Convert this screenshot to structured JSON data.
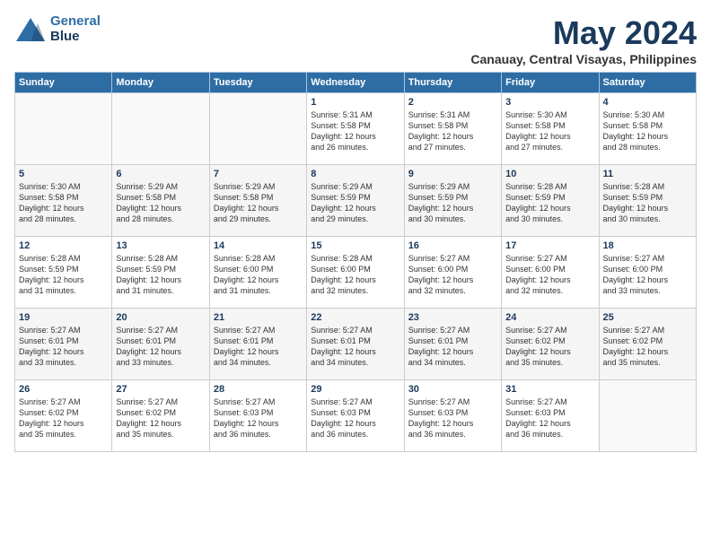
{
  "header": {
    "logo_line1": "General",
    "logo_line2": "Blue",
    "month": "May 2024",
    "location": "Canauay, Central Visayas, Philippines"
  },
  "days_of_week": [
    "Sunday",
    "Monday",
    "Tuesday",
    "Wednesday",
    "Thursday",
    "Friday",
    "Saturday"
  ],
  "weeks": [
    [
      {
        "day": "",
        "info": ""
      },
      {
        "day": "",
        "info": ""
      },
      {
        "day": "",
        "info": ""
      },
      {
        "day": "1",
        "info": "Sunrise: 5:31 AM\nSunset: 5:58 PM\nDaylight: 12 hours\nand 26 minutes."
      },
      {
        "day": "2",
        "info": "Sunrise: 5:31 AM\nSunset: 5:58 PM\nDaylight: 12 hours\nand 27 minutes."
      },
      {
        "day": "3",
        "info": "Sunrise: 5:30 AM\nSunset: 5:58 PM\nDaylight: 12 hours\nand 27 minutes."
      },
      {
        "day": "4",
        "info": "Sunrise: 5:30 AM\nSunset: 5:58 PM\nDaylight: 12 hours\nand 28 minutes."
      }
    ],
    [
      {
        "day": "5",
        "info": "Sunrise: 5:30 AM\nSunset: 5:58 PM\nDaylight: 12 hours\nand 28 minutes."
      },
      {
        "day": "6",
        "info": "Sunrise: 5:29 AM\nSunset: 5:58 PM\nDaylight: 12 hours\nand 28 minutes."
      },
      {
        "day": "7",
        "info": "Sunrise: 5:29 AM\nSunset: 5:58 PM\nDaylight: 12 hours\nand 29 minutes."
      },
      {
        "day": "8",
        "info": "Sunrise: 5:29 AM\nSunset: 5:59 PM\nDaylight: 12 hours\nand 29 minutes."
      },
      {
        "day": "9",
        "info": "Sunrise: 5:29 AM\nSunset: 5:59 PM\nDaylight: 12 hours\nand 30 minutes."
      },
      {
        "day": "10",
        "info": "Sunrise: 5:28 AM\nSunset: 5:59 PM\nDaylight: 12 hours\nand 30 minutes."
      },
      {
        "day": "11",
        "info": "Sunrise: 5:28 AM\nSunset: 5:59 PM\nDaylight: 12 hours\nand 30 minutes."
      }
    ],
    [
      {
        "day": "12",
        "info": "Sunrise: 5:28 AM\nSunset: 5:59 PM\nDaylight: 12 hours\nand 31 minutes."
      },
      {
        "day": "13",
        "info": "Sunrise: 5:28 AM\nSunset: 5:59 PM\nDaylight: 12 hours\nand 31 minutes."
      },
      {
        "day": "14",
        "info": "Sunrise: 5:28 AM\nSunset: 6:00 PM\nDaylight: 12 hours\nand 31 minutes."
      },
      {
        "day": "15",
        "info": "Sunrise: 5:28 AM\nSunset: 6:00 PM\nDaylight: 12 hours\nand 32 minutes."
      },
      {
        "day": "16",
        "info": "Sunrise: 5:27 AM\nSunset: 6:00 PM\nDaylight: 12 hours\nand 32 minutes."
      },
      {
        "day": "17",
        "info": "Sunrise: 5:27 AM\nSunset: 6:00 PM\nDaylight: 12 hours\nand 32 minutes."
      },
      {
        "day": "18",
        "info": "Sunrise: 5:27 AM\nSunset: 6:00 PM\nDaylight: 12 hours\nand 33 minutes."
      }
    ],
    [
      {
        "day": "19",
        "info": "Sunrise: 5:27 AM\nSunset: 6:01 PM\nDaylight: 12 hours\nand 33 minutes."
      },
      {
        "day": "20",
        "info": "Sunrise: 5:27 AM\nSunset: 6:01 PM\nDaylight: 12 hours\nand 33 minutes."
      },
      {
        "day": "21",
        "info": "Sunrise: 5:27 AM\nSunset: 6:01 PM\nDaylight: 12 hours\nand 34 minutes."
      },
      {
        "day": "22",
        "info": "Sunrise: 5:27 AM\nSunset: 6:01 PM\nDaylight: 12 hours\nand 34 minutes."
      },
      {
        "day": "23",
        "info": "Sunrise: 5:27 AM\nSunset: 6:01 PM\nDaylight: 12 hours\nand 34 minutes."
      },
      {
        "day": "24",
        "info": "Sunrise: 5:27 AM\nSunset: 6:02 PM\nDaylight: 12 hours\nand 35 minutes."
      },
      {
        "day": "25",
        "info": "Sunrise: 5:27 AM\nSunset: 6:02 PM\nDaylight: 12 hours\nand 35 minutes."
      }
    ],
    [
      {
        "day": "26",
        "info": "Sunrise: 5:27 AM\nSunset: 6:02 PM\nDaylight: 12 hours\nand 35 minutes."
      },
      {
        "day": "27",
        "info": "Sunrise: 5:27 AM\nSunset: 6:02 PM\nDaylight: 12 hours\nand 35 minutes."
      },
      {
        "day": "28",
        "info": "Sunrise: 5:27 AM\nSunset: 6:03 PM\nDaylight: 12 hours\nand 36 minutes."
      },
      {
        "day": "29",
        "info": "Sunrise: 5:27 AM\nSunset: 6:03 PM\nDaylight: 12 hours\nand 36 minutes."
      },
      {
        "day": "30",
        "info": "Sunrise: 5:27 AM\nSunset: 6:03 PM\nDaylight: 12 hours\nand 36 minutes."
      },
      {
        "day": "31",
        "info": "Sunrise: 5:27 AM\nSunset: 6:03 PM\nDaylight: 12 hours\nand 36 minutes."
      },
      {
        "day": "",
        "info": ""
      }
    ]
  ]
}
